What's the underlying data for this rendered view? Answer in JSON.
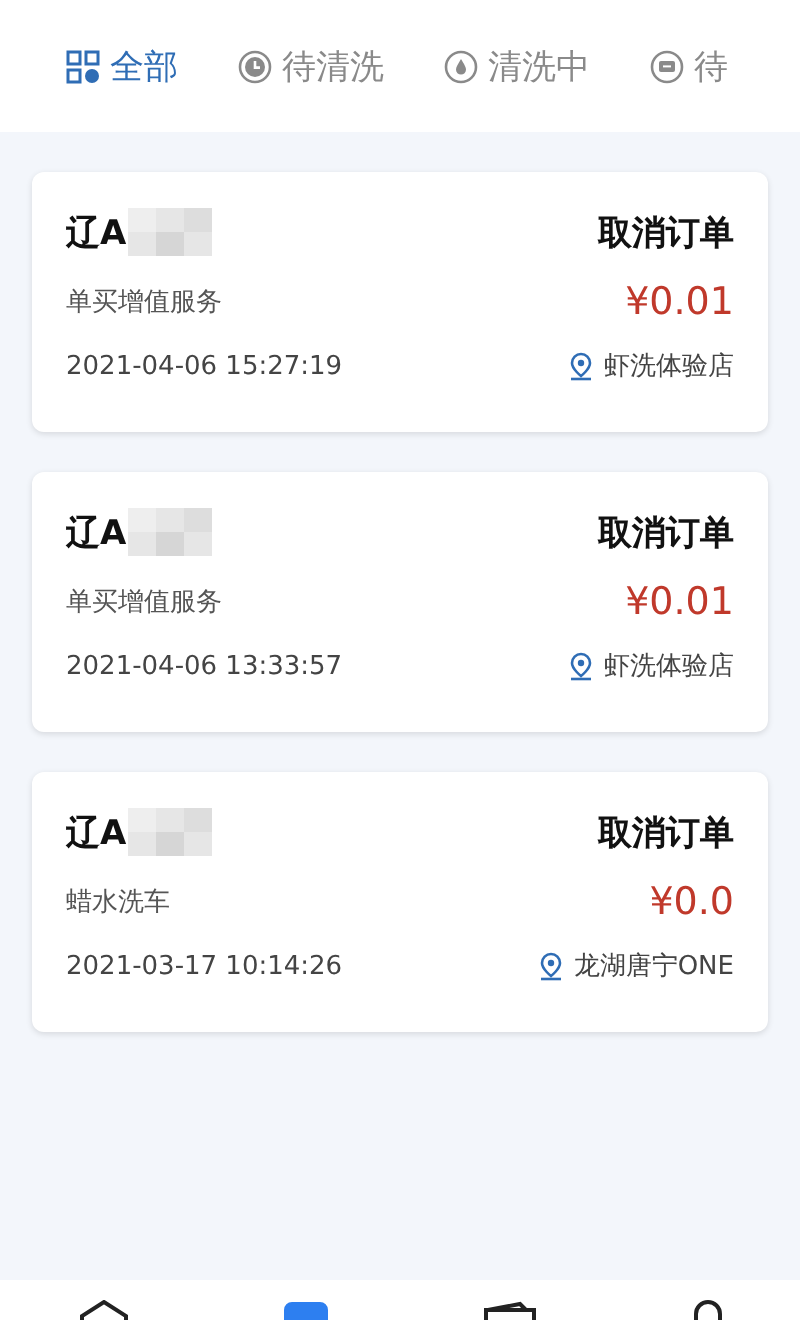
{
  "tabs": [
    {
      "label": "全部",
      "kind": "grid",
      "selected": true
    },
    {
      "label": "待清洗",
      "kind": "clock",
      "selected": false
    },
    {
      "label": "清洗中",
      "kind": "drop",
      "selected": false
    },
    {
      "label": "待",
      "kind": "chat",
      "selected": false
    }
  ],
  "orders": [
    {
      "plate": "辽A",
      "action": "取消订单",
      "service": "单买增值服务",
      "price": "¥0.01",
      "time": "2021-04-06 15:27:19",
      "store": "虾洗体验店"
    },
    {
      "plate": "辽A",
      "action": "取消订单",
      "service": "单买增值服务",
      "price": "¥0.01",
      "time": "2021-04-06 13:33:57",
      "store": "虾洗体验店"
    },
    {
      "plate": "辽A",
      "action": "取消订单",
      "service": "蜡水洗车",
      "price": "¥0.0",
      "time": "2021-03-17 10:14:26",
      "store": "龙湖唐宁ONE"
    }
  ],
  "bottom_nav": [
    {
      "kind": "home",
      "selected": false
    },
    {
      "kind": "orders",
      "selected": true
    },
    {
      "kind": "wallet",
      "selected": false
    },
    {
      "kind": "user",
      "selected": false
    }
  ]
}
